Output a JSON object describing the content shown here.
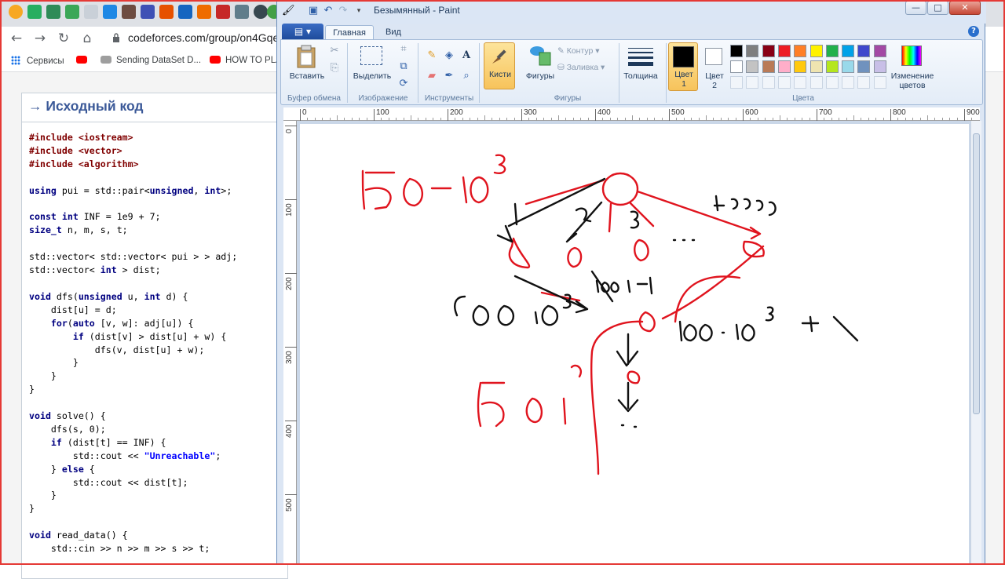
{
  "browser": {
    "url": "codeforces.com/group/on4GqeC",
    "bookmarks": [
      "Сервисы",
      "Sending DataSet D...",
      "HOW TO PLA"
    ],
    "tab_icons": [
      "app-icon",
      "leaf-icon",
      "grid-icon",
      "grid-icon",
      "doc-icon",
      "ship-icon",
      "box-icon",
      "stack-icon",
      "p-icon",
      "m-icon",
      "logo-icon",
      "u-icon",
      "circle-icon"
    ]
  },
  "panel": {
    "title": "→ Исходный код",
    "code": [
      [
        [
          "pp",
          "#include <iostream>"
        ]
      ],
      [
        [
          "pp",
          "#include <vector>"
        ]
      ],
      [
        [
          "pp",
          "#include <algorithm>"
        ]
      ],
      [],
      [
        [
          "kw",
          "using"
        ],
        [
          "",
          " pui = std::pair<"
        ],
        [
          "kw",
          "unsigned"
        ],
        [
          "",
          ", "
        ],
        [
          "kw",
          "int"
        ],
        [
          "",
          ">;"
        ]
      ],
      [],
      [
        [
          "kw",
          "const int"
        ],
        [
          "",
          " INF = 1e9 + 7;"
        ]
      ],
      [
        [
          "kw",
          "size_t"
        ],
        [
          "",
          " n, m, s, t;"
        ]
      ],
      [],
      [
        [
          "",
          "std::vector< std::vector< pui > > adj;"
        ]
      ],
      [
        [
          "",
          "std::vector< "
        ],
        [
          "kw",
          "int"
        ],
        [
          "",
          " > dist;"
        ]
      ],
      [],
      [
        [
          "kw",
          "void"
        ],
        [
          "",
          " dfs("
        ],
        [
          "kw",
          "unsigned"
        ],
        [
          "",
          " u, "
        ],
        [
          "kw",
          "int"
        ],
        [
          "",
          " d) {"
        ]
      ],
      [
        [
          "",
          "    dist[u] = d;"
        ]
      ],
      [
        [
          "",
          "    "
        ],
        [
          "kw",
          "for"
        ],
        [
          "",
          "("
        ],
        [
          "kw",
          "auto"
        ],
        [
          "",
          " [v, w]: adj[u]) {"
        ]
      ],
      [
        [
          "",
          "        "
        ],
        [
          "kw",
          "if"
        ],
        [
          "",
          " (dist[v] > dist[u] + w) {"
        ]
      ],
      [
        [
          "",
          "            dfs(v, dist[u] + w);"
        ]
      ],
      [
        [
          "",
          "        }"
        ]
      ],
      [
        [
          "",
          "    }"
        ]
      ],
      [
        [
          "",
          "}"
        ]
      ],
      [],
      [
        [
          "kw",
          "void"
        ],
        [
          "",
          " solve() {"
        ]
      ],
      [
        [
          "",
          "    dfs(s, 0);"
        ]
      ],
      [
        [
          "",
          "    "
        ],
        [
          "kw",
          "if"
        ],
        [
          "",
          " (dist[t] == INF) {"
        ]
      ],
      [
        [
          "",
          "        std::cout << "
        ],
        [
          "st",
          "\"Unreachable\""
        ],
        [
          "",
          ";"
        ]
      ],
      [
        [
          "",
          "    } "
        ],
        [
          "kw",
          "else"
        ],
        [
          "",
          " {"
        ]
      ],
      [
        [
          "",
          "        std::cout << dist[t];"
        ]
      ],
      [
        [
          "",
          "    }"
        ]
      ],
      [
        [
          "",
          "}"
        ]
      ],
      [],
      [
        [
          "kw",
          "void"
        ],
        [
          "",
          " read_data() {"
        ]
      ],
      [
        [
          "",
          "    std::cin >> n >> m >> s >> t;"
        ]
      ]
    ]
  },
  "paint": {
    "title": "Безымянный - Paint",
    "tabs": [
      "Главная",
      "Вид"
    ],
    "groups": {
      "clipboard": "Буфер обмена",
      "image": "Изображение",
      "tools": "Инструменты",
      "shapes": "Фигуры",
      "colors": "Цвета"
    },
    "buttons": {
      "paste": "Вставить",
      "select": "Выделить",
      "brushes": "Кисти",
      "shapes": "Фигуры",
      "outline": "Контур",
      "fill": "Заливка",
      "thickness": "Толщина",
      "color1_a": "Цвет",
      "color1_b": "1",
      "color2_a": "Цвет",
      "color2_b": "2",
      "edit_colors_a": "Изменение",
      "edit_colors_b": "цветов"
    },
    "palette_row1": [
      "#000000",
      "#7f7f7f",
      "#880015",
      "#ed1c24",
      "#ff7f27",
      "#fff200",
      "#22b14c",
      "#00a2e8",
      "#3f48cc",
      "#a349a4"
    ],
    "palette_row2": [
      "#ffffff",
      "#c3c3c3",
      "#b97a57",
      "#ffaec9",
      "#ffc90e",
      "#efe4b0",
      "#b5e61d",
      "#99d9ea",
      "#7092be",
      "#c8bfe7"
    ],
    "ruler_h": [
      "0",
      "100",
      "200",
      "300",
      "400",
      "500",
      "600",
      "700",
      "800",
      "900"
    ],
    "ruler_v": [
      "0",
      "100",
      "200",
      "300",
      "400",
      "500"
    ],
    "drawing_text": {
      "a": "50·10³",
      "b": "1",
      "c": "2",
      "d": "3",
      "e": "...",
      "f": "49999",
      "g": "100·10³",
      "h": "100·10³-2",
      "i": "100·10³+1",
      "j": "50·10³"
    }
  }
}
